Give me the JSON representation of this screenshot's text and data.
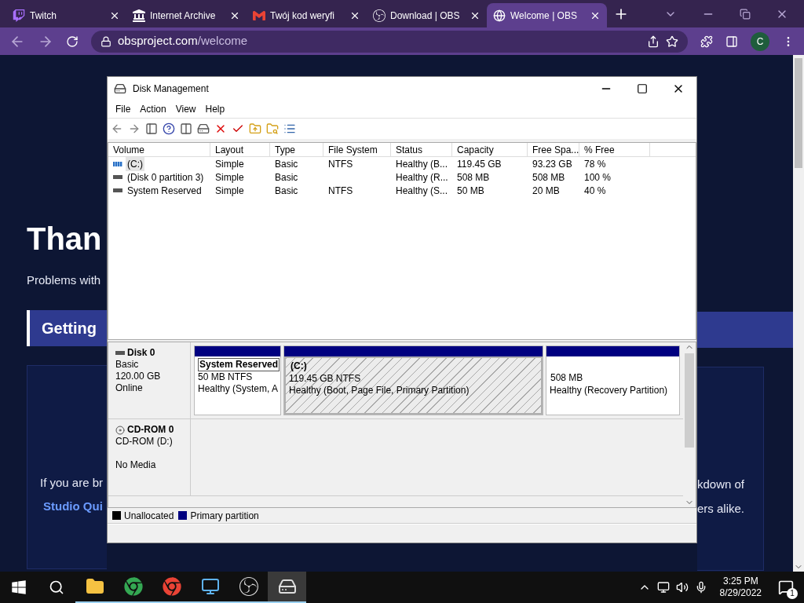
{
  "browser": {
    "tabs": [
      {
        "title": "Twitch",
        "kind": "twitch",
        "selected": false
      },
      {
        "title": "Internet Archive",
        "kind": "archive",
        "selected": false
      },
      {
        "title": "Twój kod weryfi",
        "kind": "mail",
        "selected": false
      },
      {
        "title": "Download | OBS",
        "kind": "obs",
        "selected": false
      },
      {
        "title": "Welcome | OBS",
        "kind": "globe",
        "selected": true
      }
    ],
    "url_host": "obsproject.com",
    "url_path": "/welcome",
    "profile": "C"
  },
  "page": {
    "heading": "Than",
    "subtitle": "Problems with",
    "banner": "Getting",
    "card_left": [
      {
        "text": "If you are br",
        "kind": "plain"
      },
      {
        "text": "Studio Qui",
        "kind": "link"
      }
    ],
    "card_right": [
      "kdown of",
      "ers alike."
    ]
  },
  "window": {
    "title": "Disk Management",
    "menu": [
      "File",
      "Action",
      "View",
      "Help"
    ],
    "volumes": {
      "columns": [
        "Volume",
        "Layout",
        "Type",
        "File System",
        "Status",
        "Capacity",
        "Free Spa...",
        "% Free"
      ],
      "rows": [
        {
          "kind": "boot",
          "selected": true,
          "cells": [
            "(C:)",
            "Simple",
            "Basic",
            "NTFS",
            "Healthy (B...",
            "119.45 GB",
            "93.23 GB",
            "78 %"
          ]
        },
        {
          "kind": "plain",
          "selected": false,
          "cells": [
            "(Disk 0 partition 3)",
            "Simple",
            "Basic",
            "",
            "Healthy (R...",
            "508 MB",
            "508 MB",
            "100 %"
          ]
        },
        {
          "kind": "plain",
          "selected": false,
          "cells": [
            "System Reserved",
            "Simple",
            "Basic",
            "NTFS",
            "Healthy (S...",
            "50 MB",
            "20 MB",
            "40 %"
          ]
        }
      ]
    },
    "disks": [
      {
        "name": "Disk 0",
        "kind": "disk",
        "type": "Basic",
        "size": "120.00 GB",
        "status": "Online",
        "partitions": [
          {
            "name": "System Reserved",
            "lines": [
              "50 MB NTFS",
              "Healthy (System, A"
            ],
            "selected": true,
            "hatched": false,
            "color": "#000080"
          },
          {
            "name": "(C:)",
            "lines": [
              "119.45 GB NTFS",
              "Healthy (Boot, Page File, Primary Partition)"
            ],
            "selected": false,
            "hatched": true,
            "color": "#000080"
          },
          {
            "lines": [
              "508 MB",
              "Healthy (Recovery Partition)"
            ],
            "selected": false,
            "hatched": false,
            "color": "#000080"
          }
        ]
      },
      {
        "name": "CD-ROM 0",
        "kind": "cdrom",
        "type": "CD-ROM (D:)",
        "status": "No Media"
      }
    ],
    "legend": [
      {
        "label": "Unallocated",
        "color": "#000000"
      },
      {
        "label": "Primary partition",
        "color": "#000080"
      }
    ]
  },
  "taskbar": {
    "apps": [
      {
        "kind": "folder",
        "active": false
      },
      {
        "kind": "chrome-person",
        "active": false
      },
      {
        "kind": "chrome-c",
        "active": false
      },
      {
        "kind": "panel",
        "active": false
      },
      {
        "kind": "obs",
        "active": false
      },
      {
        "kind": "disk",
        "active": true
      }
    ],
    "time": "3:25 PM",
    "date": "8/29/2022",
    "notifications": "1"
  }
}
